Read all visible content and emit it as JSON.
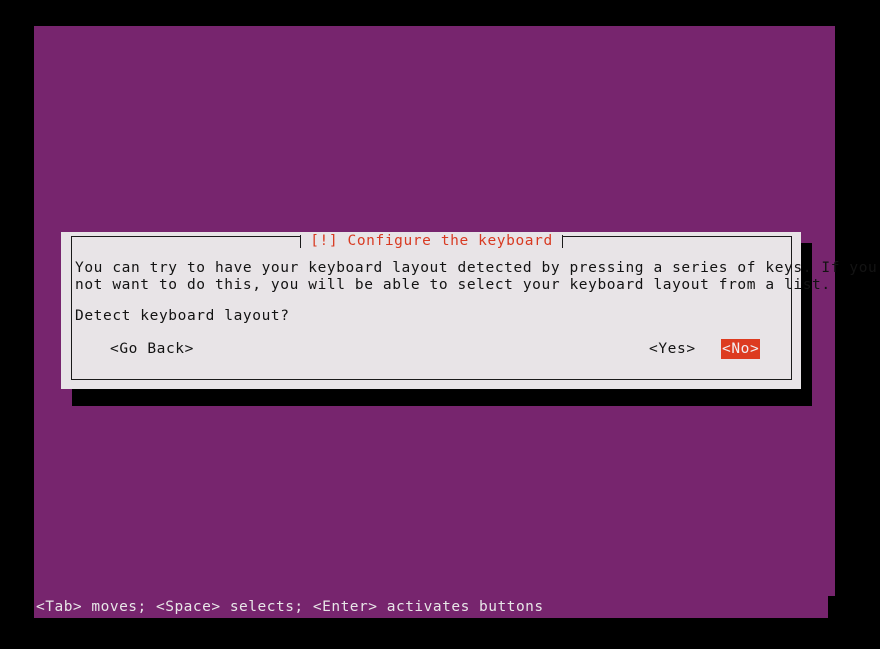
{
  "screen": {
    "backdrop_color": "#77256e",
    "outer_color": "#000000"
  },
  "dialog": {
    "title": "[!] Configure the keyboard",
    "title_color": "#d83a22",
    "background_color": "#e8e4e7",
    "description_line_1": "You can try to have your keyboard layout detected by pressing a series of keys. If you do",
    "description_line_2": "not want to do this, you will be able to select your keyboard layout from a list.",
    "question": "Detect keyboard layout?",
    "buttons": [
      {
        "label": "<Go Back>",
        "selected": false
      },
      {
        "label": "<Yes>",
        "selected": false
      },
      {
        "label": "<No>",
        "selected": true
      }
    ],
    "selected_button_background": "#dd3b20",
    "selected_button_color": "#f2eef1"
  },
  "statusbar": {
    "text": "<Tab> moves; <Space> selects; <Enter> activates buttons",
    "background_color": "#77256e",
    "color": "#e8e6e8"
  }
}
